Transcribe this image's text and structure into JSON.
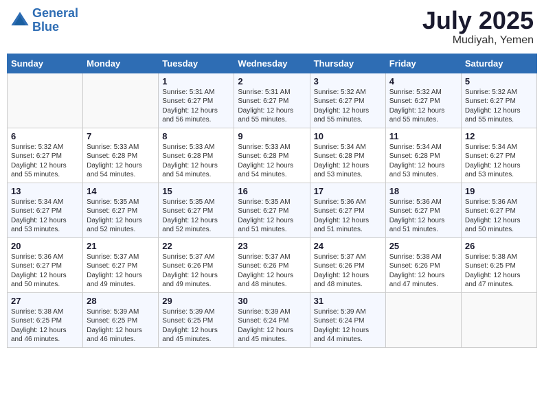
{
  "header": {
    "logo_line1": "General",
    "logo_line2": "Blue",
    "month": "July 2025",
    "location": "Mudiyah, Yemen"
  },
  "weekdays": [
    "Sunday",
    "Monday",
    "Tuesday",
    "Wednesday",
    "Thursday",
    "Friday",
    "Saturday"
  ],
  "weeks": [
    [
      {
        "day": "",
        "sunrise": "",
        "sunset": "",
        "daylight": ""
      },
      {
        "day": "",
        "sunrise": "",
        "sunset": "",
        "daylight": ""
      },
      {
        "day": "1",
        "sunrise": "Sunrise: 5:31 AM",
        "sunset": "Sunset: 6:27 PM",
        "daylight": "Daylight: 12 hours and 56 minutes."
      },
      {
        "day": "2",
        "sunrise": "Sunrise: 5:31 AM",
        "sunset": "Sunset: 6:27 PM",
        "daylight": "Daylight: 12 hours and 55 minutes."
      },
      {
        "day": "3",
        "sunrise": "Sunrise: 5:32 AM",
        "sunset": "Sunset: 6:27 PM",
        "daylight": "Daylight: 12 hours and 55 minutes."
      },
      {
        "day": "4",
        "sunrise": "Sunrise: 5:32 AM",
        "sunset": "Sunset: 6:27 PM",
        "daylight": "Daylight: 12 hours and 55 minutes."
      },
      {
        "day": "5",
        "sunrise": "Sunrise: 5:32 AM",
        "sunset": "Sunset: 6:27 PM",
        "daylight": "Daylight: 12 hours and 55 minutes."
      }
    ],
    [
      {
        "day": "6",
        "sunrise": "Sunrise: 5:32 AM",
        "sunset": "Sunset: 6:27 PM",
        "daylight": "Daylight: 12 hours and 55 minutes."
      },
      {
        "day": "7",
        "sunrise": "Sunrise: 5:33 AM",
        "sunset": "Sunset: 6:28 PM",
        "daylight": "Daylight: 12 hours and 54 minutes."
      },
      {
        "day": "8",
        "sunrise": "Sunrise: 5:33 AM",
        "sunset": "Sunset: 6:28 PM",
        "daylight": "Daylight: 12 hours and 54 minutes."
      },
      {
        "day": "9",
        "sunrise": "Sunrise: 5:33 AM",
        "sunset": "Sunset: 6:28 PM",
        "daylight": "Daylight: 12 hours and 54 minutes."
      },
      {
        "day": "10",
        "sunrise": "Sunrise: 5:34 AM",
        "sunset": "Sunset: 6:28 PM",
        "daylight": "Daylight: 12 hours and 53 minutes."
      },
      {
        "day": "11",
        "sunrise": "Sunrise: 5:34 AM",
        "sunset": "Sunset: 6:28 PM",
        "daylight": "Daylight: 12 hours and 53 minutes."
      },
      {
        "day": "12",
        "sunrise": "Sunrise: 5:34 AM",
        "sunset": "Sunset: 6:27 PM",
        "daylight": "Daylight: 12 hours and 53 minutes."
      }
    ],
    [
      {
        "day": "13",
        "sunrise": "Sunrise: 5:34 AM",
        "sunset": "Sunset: 6:27 PM",
        "daylight": "Daylight: 12 hours and 53 minutes."
      },
      {
        "day": "14",
        "sunrise": "Sunrise: 5:35 AM",
        "sunset": "Sunset: 6:27 PM",
        "daylight": "Daylight: 12 hours and 52 minutes."
      },
      {
        "day": "15",
        "sunrise": "Sunrise: 5:35 AM",
        "sunset": "Sunset: 6:27 PM",
        "daylight": "Daylight: 12 hours and 52 minutes."
      },
      {
        "day": "16",
        "sunrise": "Sunrise: 5:35 AM",
        "sunset": "Sunset: 6:27 PM",
        "daylight": "Daylight: 12 hours and 51 minutes."
      },
      {
        "day": "17",
        "sunrise": "Sunrise: 5:36 AM",
        "sunset": "Sunset: 6:27 PM",
        "daylight": "Daylight: 12 hours and 51 minutes."
      },
      {
        "day": "18",
        "sunrise": "Sunrise: 5:36 AM",
        "sunset": "Sunset: 6:27 PM",
        "daylight": "Daylight: 12 hours and 51 minutes."
      },
      {
        "day": "19",
        "sunrise": "Sunrise: 5:36 AM",
        "sunset": "Sunset: 6:27 PM",
        "daylight": "Daylight: 12 hours and 50 minutes."
      }
    ],
    [
      {
        "day": "20",
        "sunrise": "Sunrise: 5:36 AM",
        "sunset": "Sunset: 6:27 PM",
        "daylight": "Daylight: 12 hours and 50 minutes."
      },
      {
        "day": "21",
        "sunrise": "Sunrise: 5:37 AM",
        "sunset": "Sunset: 6:27 PM",
        "daylight": "Daylight: 12 hours and 49 minutes."
      },
      {
        "day": "22",
        "sunrise": "Sunrise: 5:37 AM",
        "sunset": "Sunset: 6:26 PM",
        "daylight": "Daylight: 12 hours and 49 minutes."
      },
      {
        "day": "23",
        "sunrise": "Sunrise: 5:37 AM",
        "sunset": "Sunset: 6:26 PM",
        "daylight": "Daylight: 12 hours and 48 minutes."
      },
      {
        "day": "24",
        "sunrise": "Sunrise: 5:37 AM",
        "sunset": "Sunset: 6:26 PM",
        "daylight": "Daylight: 12 hours and 48 minutes."
      },
      {
        "day": "25",
        "sunrise": "Sunrise: 5:38 AM",
        "sunset": "Sunset: 6:26 PM",
        "daylight": "Daylight: 12 hours and 47 minutes."
      },
      {
        "day": "26",
        "sunrise": "Sunrise: 5:38 AM",
        "sunset": "Sunset: 6:25 PM",
        "daylight": "Daylight: 12 hours and 47 minutes."
      }
    ],
    [
      {
        "day": "27",
        "sunrise": "Sunrise: 5:38 AM",
        "sunset": "Sunset: 6:25 PM",
        "daylight": "Daylight: 12 hours and 46 minutes."
      },
      {
        "day": "28",
        "sunrise": "Sunrise: 5:39 AM",
        "sunset": "Sunset: 6:25 PM",
        "daylight": "Daylight: 12 hours and 46 minutes."
      },
      {
        "day": "29",
        "sunrise": "Sunrise: 5:39 AM",
        "sunset": "Sunset: 6:25 PM",
        "daylight": "Daylight: 12 hours and 45 minutes."
      },
      {
        "day": "30",
        "sunrise": "Sunrise: 5:39 AM",
        "sunset": "Sunset: 6:24 PM",
        "daylight": "Daylight: 12 hours and 45 minutes."
      },
      {
        "day": "31",
        "sunrise": "Sunrise: 5:39 AM",
        "sunset": "Sunset: 6:24 PM",
        "daylight": "Daylight: 12 hours and 44 minutes."
      },
      {
        "day": "",
        "sunrise": "",
        "sunset": "",
        "daylight": ""
      },
      {
        "day": "",
        "sunrise": "",
        "sunset": "",
        "daylight": ""
      }
    ]
  ]
}
